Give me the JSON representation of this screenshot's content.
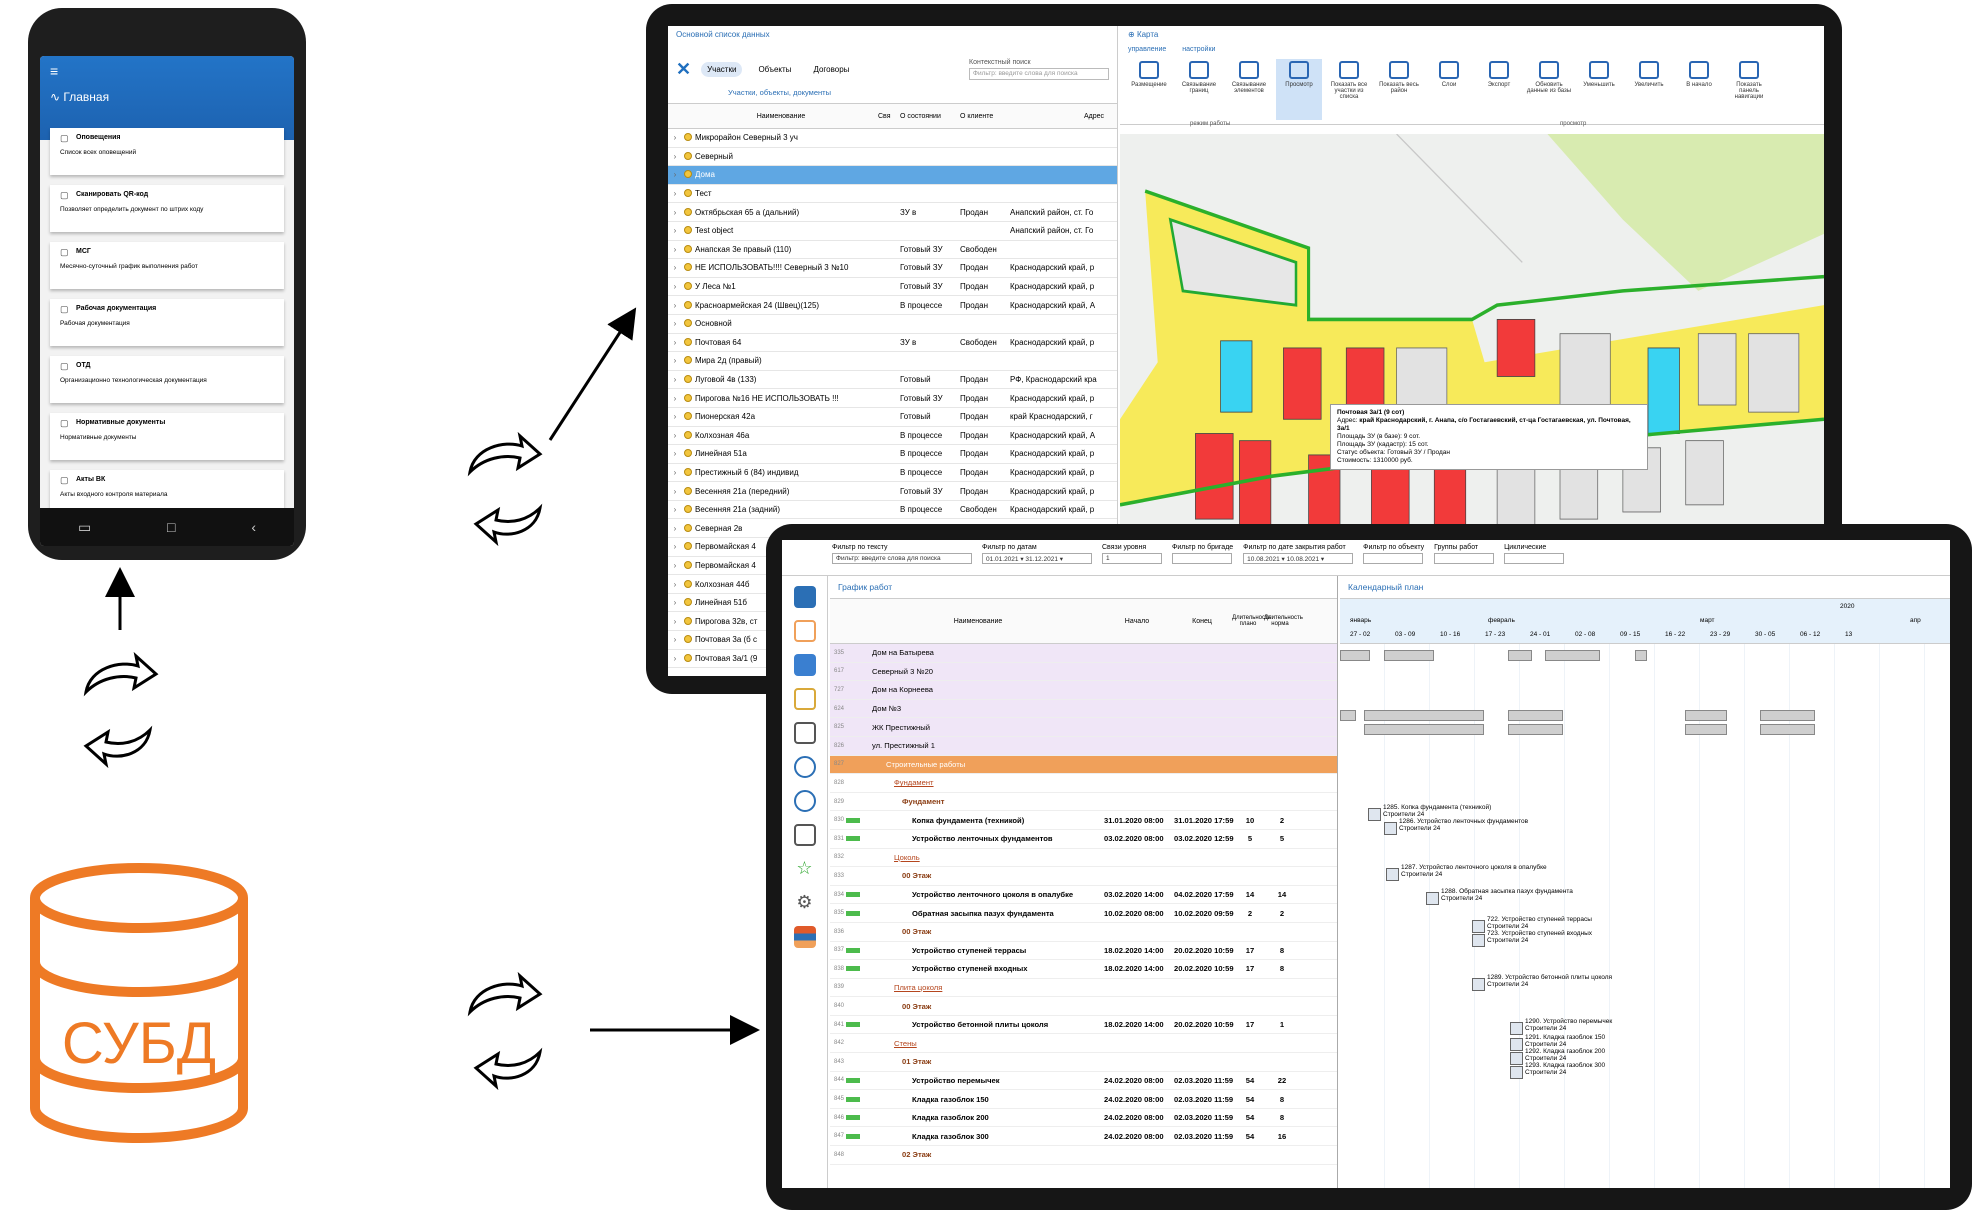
{
  "phone": {
    "header": "Главная",
    "cards": [
      {
        "title": "Оповещения",
        "sub": "Список всех оповещений",
        "icon": "bell-icon"
      },
      {
        "title": "Сканировать QR-код",
        "sub": "Позволяет определить документ по штрих коду",
        "icon": "qr-icon"
      },
      {
        "title": "МСГ",
        "sub": "Месячно-суточный график выполнения работ",
        "icon": "calendar-icon"
      },
      {
        "title": "Рабочая документация",
        "sub": "Рабочая документация",
        "icon": "layers-icon"
      },
      {
        "title": "ОТД",
        "sub": "Организационно технологическая документация",
        "icon": "folder-icon"
      },
      {
        "title": "Нормативные документы",
        "sub": "Нормативные документы",
        "icon": "layers-icon"
      },
      {
        "title": "Акты ВК",
        "sub": "Акты входного контроля материала",
        "icon": "file-icon"
      }
    ]
  },
  "list": {
    "title": "Основной список данных",
    "tabs": [
      "Участки",
      "Объекты",
      "Договоры"
    ],
    "subtitle": "Участки, объекты, документы",
    "filter_label": "Контекстный поиск",
    "filter_placeholder": "Фильтр: введите слова для поиска",
    "columns": [
      "Наименование",
      "Свя",
      "О состоянии",
      "О клиенте",
      "Адрес"
    ],
    "rows": [
      [
        "Микрорайон Северный 3 уч",
        "",
        "",
        "",
        ""
      ],
      [
        "Северный",
        "",
        "",
        "",
        ""
      ],
      [
        "Дома",
        "",
        "",
        "",
        ""
      ],
      [
        "Тест",
        "",
        "",
        "",
        ""
      ],
      [
        "Октябрьская 65 а (дальний)",
        "",
        "ЗУ в",
        "Продан",
        "Анапский район, ст. Го"
      ],
      [
        "Test object",
        "",
        "",
        "",
        "Анапский район, ст. Го"
      ],
      [
        "Анапская 3е правый (110)",
        "",
        "Готовый ЗУ",
        "Свободен",
        ""
      ],
      [
        "НЕ ИСПОЛЬЗОВАТЬ!!!! Северный 3 №10",
        "",
        "Готовый ЗУ",
        "Продан",
        "Краснодарский край, р"
      ],
      [
        "У Леса №1",
        "",
        "Готовый ЗУ",
        "Продан",
        "Краснодарский край, р"
      ],
      [
        "Красноармейская 24 (Швец)(125)",
        "",
        "В процессе",
        "Продан",
        "Краснодарский край, А"
      ],
      [
        "Основной",
        "",
        "",
        "",
        ""
      ],
      [
        "Почтовая 64",
        "",
        "ЗУ в",
        "Свободен",
        "Краснодарский край, р"
      ],
      [
        "Мира 2д (правый)",
        "",
        "",
        "",
        ""
      ],
      [
        "Луговой 4в (133)",
        "",
        "Готовый",
        "Продан",
        "РФ, Краснодарский кра"
      ],
      [
        "Пирогова №16 НЕ ИСПОЛЬЗОВАТЬ !!!",
        "",
        "Готовый ЗУ",
        "Продан",
        "Краснодарский край, р"
      ],
      [
        "Пионерская 42а",
        "",
        "Готовый",
        "Продан",
        "край Краснодарский, г"
      ],
      [
        "Колхозная 46а",
        "",
        "В процессе",
        "Продан",
        "Краснодарский край, А"
      ],
      [
        "Линейная 51а",
        "",
        "В процессе",
        "Продан",
        "Краснодарский край, р"
      ],
      [
        "Престижный 6 (84) индивид",
        "",
        "В процессе",
        "Продан",
        "Краснодарский край, р"
      ],
      [
        "Весенняя 21а (передний)",
        "",
        "Готовый ЗУ",
        "Продан",
        "Краснодарский край, р"
      ],
      [
        "Весенняя 21а (задний)",
        "",
        "В процессе",
        "Свободен",
        "Краснодарский край, р"
      ],
      [
        "Северная 2в",
        "",
        "",
        "",
        ""
      ],
      [
        "Первомайская 4",
        "",
        "",
        "",
        ""
      ],
      [
        "Первомайская 4",
        "",
        "",
        "",
        ""
      ],
      [
        "Колхозная 44б",
        "",
        "",
        "",
        ""
      ],
      [
        "Линейная 51б",
        "",
        "",
        "",
        ""
      ],
      [
        "Пирогова 32в, ст",
        "",
        "",
        "",
        ""
      ],
      [
        "Почтовая 3а (б с",
        "",
        "",
        "",
        ""
      ],
      [
        "Почтовая 3а/1 (9",
        "",
        "",
        "",
        ""
      ]
    ]
  },
  "map": {
    "title": "Карта",
    "tabs": [
      "управление",
      "настройки"
    ],
    "ribbon": [
      "Размещение",
      "Связывание границ",
      "Связывание элементов",
      "Просмотр",
      "Показать все участки из списка",
      "Показать весь район",
      "Слои",
      "Экспорт",
      "Обновить данные из базы",
      "Уменьшить",
      "Увеличить",
      "В начало",
      "Показать панель навигации"
    ],
    "group1": "режим работы",
    "group2": "просмотр",
    "tooltip": {
      "title": "Почтовая 3а/1 (9 сот)",
      "addr_label": "Адрес:",
      "addr": "край Краснодарский, г. Анапа, с/о Гостагаевский, ст-ца Гостагаевская, ул. Почтовая, 3а/1",
      "area1": "Площадь ЗУ (в базе):  9 сот.",
      "area2": "Площадь ЗУ (кадастр):  15 сот.",
      "status": "Статус объекта:  Готовый ЗУ / Продан",
      "price": "Стоимость:  1310000 руб."
    }
  },
  "filters": [
    {
      "label": "Фильтр по тексту",
      "value": "Фильтр: введите слова для поиска"
    },
    {
      "label": "Фильтр по датам",
      "value": "01.01.2021  ▾  31.12.2021  ▾"
    },
    {
      "label": "Связи уровня",
      "value": "1"
    },
    {
      "label": "Фильтр по бригаде",
      "value": ""
    },
    {
      "label": "Фильтр по дате закрытия работ",
      "value": "10.08.2021  ▾  10.08.2021  ▾"
    },
    {
      "label": "Фильтр по объекту",
      "value": ""
    },
    {
      "label": "Группы работ",
      "value": ""
    },
    {
      "label": "Циклические",
      "value": ""
    }
  ],
  "gantt": {
    "title": "График работ",
    "columns": [
      "Наименование",
      "Начало",
      "Конец",
      "Длительность плано",
      "Длительность норма"
    ],
    "rows": [
      {
        "n": "335",
        "name": "Дом на Батырева",
        "start": "",
        "end": "",
        "d1": "",
        "d2": "",
        "style": "lev0"
      },
      {
        "n": "617",
        "name": "Северный 3 №20",
        "start": "",
        "end": "",
        "d1": "",
        "d2": "",
        "style": "lev0"
      },
      {
        "n": "727",
        "name": "Дом на Корнеева",
        "start": "",
        "end": "",
        "d1": "",
        "d2": "",
        "style": "lev0"
      },
      {
        "n": "624",
        "name": "Дом №3",
        "start": "",
        "end": "",
        "d1": "",
        "d2": "",
        "style": "lev0"
      },
      {
        "n": "825",
        "name": "ЖК Престижный",
        "start": "",
        "end": "",
        "d1": "",
        "d2": "",
        "style": "lev0"
      },
      {
        "n": "826",
        "name": "ул. Престижный 1",
        "start": "",
        "end": "",
        "d1": "",
        "d2": "",
        "style": "lev0"
      },
      {
        "n": "827",
        "name": "Строительные работы",
        "start": "",
        "end": "",
        "d1": "",
        "d2": "",
        "style": "band"
      },
      {
        "n": "828",
        "name": "Фундамент",
        "start": "",
        "end": "",
        "d1": "",
        "d2": "",
        "style": "ulink"
      },
      {
        "n": "829",
        "name": "Фундамент",
        "start": "",
        "end": "",
        "d1": "",
        "d2": "",
        "style": "brown"
      },
      {
        "n": "830",
        "name": "Копка фундамента (техникой)",
        "start": "31.01.2020 08:00",
        "end": "31.01.2020 17:59",
        "d1": "10",
        "d2": "2",
        "style": "bold"
      },
      {
        "n": "831",
        "name": "Устройство ленточных фундаментов",
        "start": "03.02.2020 08:00",
        "end": "03.02.2020 12:59",
        "d1": "5",
        "d2": "5",
        "style": "bold"
      },
      {
        "n": "832",
        "name": "Цоколь",
        "start": "",
        "end": "",
        "d1": "",
        "d2": "",
        "style": "ulink"
      },
      {
        "n": "833",
        "name": "00 Этаж",
        "start": "",
        "end": "",
        "d1": "",
        "d2": "",
        "style": "brown"
      },
      {
        "n": "834",
        "name": "Устройство ленточного цоколя в опалубке",
        "start": "03.02.2020 14:00",
        "end": "04.02.2020 17:59",
        "d1": "14",
        "d2": "14",
        "style": "bold"
      },
      {
        "n": "835",
        "name": "Обратная засыпка пазух фундамента",
        "start": "10.02.2020 08:00",
        "end": "10.02.2020 09:59",
        "d1": "2",
        "d2": "2",
        "style": "bold"
      },
      {
        "n": "836",
        "name": "00 Этаж",
        "start": "",
        "end": "",
        "d1": "",
        "d2": "",
        "style": "brown"
      },
      {
        "n": "837",
        "name": "Устройство ступеней террасы",
        "start": "18.02.2020 14:00",
        "end": "20.02.2020 10:59",
        "d1": "17",
        "d2": "8",
        "style": "bold"
      },
      {
        "n": "838",
        "name": "Устройство ступеней входных",
        "start": "18.02.2020 14:00",
        "end": "20.02.2020 10:59",
        "d1": "17",
        "d2": "8",
        "style": "bold"
      },
      {
        "n": "839",
        "name": "Плита цоколя",
        "start": "",
        "end": "",
        "d1": "",
        "d2": "",
        "style": "ulink"
      },
      {
        "n": "840",
        "name": "00 Этаж",
        "start": "",
        "end": "",
        "d1": "",
        "d2": "",
        "style": "brown"
      },
      {
        "n": "841",
        "name": "Устройство бетонной плиты цоколя",
        "start": "18.02.2020 14:00",
        "end": "20.02.2020 10:59",
        "d1": "17",
        "d2": "1",
        "style": "bold"
      },
      {
        "n": "842",
        "name": "Стены",
        "start": "",
        "end": "",
        "d1": "",
        "d2": "",
        "style": "ulink"
      },
      {
        "n": "843",
        "name": "01 Этаж",
        "start": "",
        "end": "",
        "d1": "",
        "d2": "",
        "style": "brown"
      },
      {
        "n": "844",
        "name": "Устройство перемычек",
        "start": "24.02.2020 08:00",
        "end": "02.03.2020 11:59",
        "d1": "54",
        "d2": "22",
        "style": "bold"
      },
      {
        "n": "845",
        "name": "Кладка газоблок 150",
        "start": "24.02.2020 08:00",
        "end": "02.03.2020 11:59",
        "d1": "54",
        "d2": "8",
        "style": "bold"
      },
      {
        "n": "846",
        "name": "Кладка газоблок 200",
        "start": "24.02.2020 08:00",
        "end": "02.03.2020 11:59",
        "d1": "54",
        "d2": "8",
        "style": "bold"
      },
      {
        "n": "847",
        "name": "Кладка газоблок 300",
        "start": "24.02.2020 08:00",
        "end": "02.03.2020 11:59",
        "d1": "54",
        "d2": "16",
        "style": "bold"
      },
      {
        "n": "848",
        "name": "02 Этаж",
        "start": "",
        "end": "",
        "d1": "",
        "d2": "",
        "style": "brown"
      }
    ]
  },
  "calendar": {
    "title": "Календарный план",
    "year": "2020",
    "months": [
      "январь",
      "февраль",
      "март",
      "апр"
    ],
    "weeks": [
      "27 - 02",
      "03 - 09",
      "10 - 16",
      "17 - 23",
      "24 - 01",
      "02 - 08",
      "09 - 15",
      "16 - 22",
      "23 - 29",
      "30 - 05",
      "06 - 12",
      "13"
    ],
    "tasks": [
      "1285. Копка фундамента (техникой)",
      "1286. Устройство ленточных фундаментов",
      "1287. Устройство ленточного цоколя в опалубке",
      "1288. Обратная засыпка пазух фундамента",
      "722. Устройство ступеней террасы",
      "723. Устройство ступеней входных",
      "1289. Устройство бетонной плиты цоколя",
      "1290. Устройство перемычек",
      "1291. Кладка газоблок 150",
      "1292. Кладка газоблок 200",
      "1293. Кладка газоблок 300"
    ],
    "brigade": "Строители 24"
  },
  "db": {
    "label": "СУБД"
  },
  "colors": {
    "accent": "#2b6fb5",
    "db": "#ee7a25",
    "selection": "#5fa7e3",
    "sold": "#f23a3a",
    "free": "#39d3f2",
    "road": "#f7ea5a"
  }
}
